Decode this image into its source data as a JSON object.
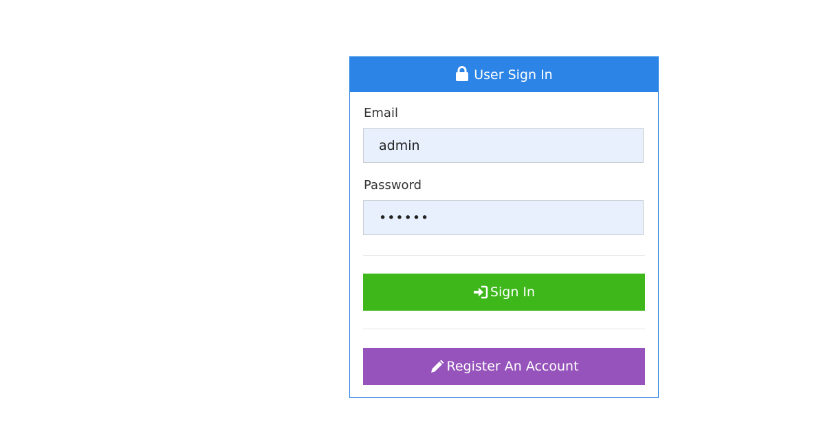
{
  "heading": {
    "icon": "lock-icon",
    "title": "User Sign In",
    "color": "#2b84e6"
  },
  "form": {
    "email_label": "Email",
    "email_value": "admin",
    "password_label": "Password",
    "password_value": "••••••"
  },
  "buttons": {
    "signin_icon": "sign-in-icon",
    "signin_label": "Sign In",
    "signin_color": "#3eb71b",
    "register_icon": "pencil-icon",
    "register_label": "Register An Account",
    "register_color": "#9653bb"
  }
}
